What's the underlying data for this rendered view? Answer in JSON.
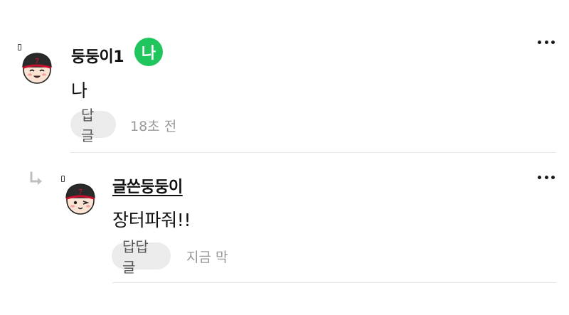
{
  "comments": [
    {
      "nickname": "둥둥이1",
      "badge": "나",
      "text": "나",
      "reply_label": "답글",
      "time": "18초 전",
      "more_icon": "more-horizontal-icon",
      "avatar_icon": "baseball-cap-avatar-icon"
    },
    {
      "nickname": "글쓴둥둥이",
      "text": "장터파줘!!",
      "reply_label": "답답글",
      "time": "지금 막",
      "more_icon": "more-horizontal-icon",
      "avatar_icon": "baseball-cap-wink-avatar-icon",
      "reply_indicator_icon": "reply-arrow-icon"
    }
  ],
  "colors": {
    "badge_green": "#21c55e",
    "reply_button_bg": "#ebebeb",
    "time_text": "#9a9a9a",
    "divider": "#e6e6e6",
    "cap_dark": "#2a2a2a",
    "cap_red": "#c8102e"
  }
}
